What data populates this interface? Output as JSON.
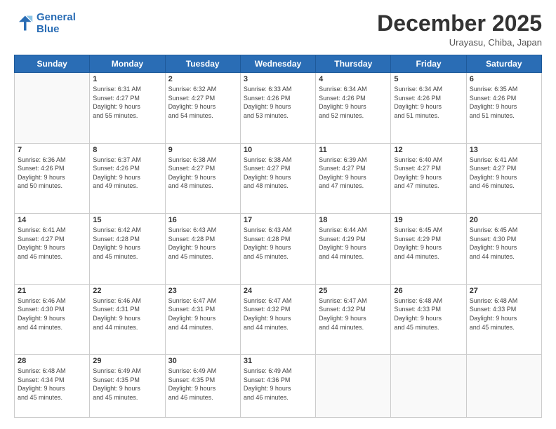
{
  "header": {
    "logo_line1": "General",
    "logo_line2": "Blue",
    "month_title": "December 2025",
    "location": "Urayasu, Chiba, Japan"
  },
  "weekdays": [
    "Sunday",
    "Monday",
    "Tuesday",
    "Wednesday",
    "Thursday",
    "Friday",
    "Saturday"
  ],
  "weeks": [
    [
      {
        "day": "",
        "info": ""
      },
      {
        "day": "1",
        "info": "Sunrise: 6:31 AM\nSunset: 4:27 PM\nDaylight: 9 hours\nand 55 minutes."
      },
      {
        "day": "2",
        "info": "Sunrise: 6:32 AM\nSunset: 4:27 PM\nDaylight: 9 hours\nand 54 minutes."
      },
      {
        "day": "3",
        "info": "Sunrise: 6:33 AM\nSunset: 4:26 PM\nDaylight: 9 hours\nand 53 minutes."
      },
      {
        "day": "4",
        "info": "Sunrise: 6:34 AM\nSunset: 4:26 PM\nDaylight: 9 hours\nand 52 minutes."
      },
      {
        "day": "5",
        "info": "Sunrise: 6:34 AM\nSunset: 4:26 PM\nDaylight: 9 hours\nand 51 minutes."
      },
      {
        "day": "6",
        "info": "Sunrise: 6:35 AM\nSunset: 4:26 PM\nDaylight: 9 hours\nand 51 minutes."
      }
    ],
    [
      {
        "day": "7",
        "info": "Sunrise: 6:36 AM\nSunset: 4:26 PM\nDaylight: 9 hours\nand 50 minutes."
      },
      {
        "day": "8",
        "info": "Sunrise: 6:37 AM\nSunset: 4:26 PM\nDaylight: 9 hours\nand 49 minutes."
      },
      {
        "day": "9",
        "info": "Sunrise: 6:38 AM\nSunset: 4:27 PM\nDaylight: 9 hours\nand 48 minutes."
      },
      {
        "day": "10",
        "info": "Sunrise: 6:38 AM\nSunset: 4:27 PM\nDaylight: 9 hours\nand 48 minutes."
      },
      {
        "day": "11",
        "info": "Sunrise: 6:39 AM\nSunset: 4:27 PM\nDaylight: 9 hours\nand 47 minutes."
      },
      {
        "day": "12",
        "info": "Sunrise: 6:40 AM\nSunset: 4:27 PM\nDaylight: 9 hours\nand 47 minutes."
      },
      {
        "day": "13",
        "info": "Sunrise: 6:41 AM\nSunset: 4:27 PM\nDaylight: 9 hours\nand 46 minutes."
      }
    ],
    [
      {
        "day": "14",
        "info": "Sunrise: 6:41 AM\nSunset: 4:27 PM\nDaylight: 9 hours\nand 46 minutes."
      },
      {
        "day": "15",
        "info": "Sunrise: 6:42 AM\nSunset: 4:28 PM\nDaylight: 9 hours\nand 45 minutes."
      },
      {
        "day": "16",
        "info": "Sunrise: 6:43 AM\nSunset: 4:28 PM\nDaylight: 9 hours\nand 45 minutes."
      },
      {
        "day": "17",
        "info": "Sunrise: 6:43 AM\nSunset: 4:28 PM\nDaylight: 9 hours\nand 45 minutes."
      },
      {
        "day": "18",
        "info": "Sunrise: 6:44 AM\nSunset: 4:29 PM\nDaylight: 9 hours\nand 44 minutes."
      },
      {
        "day": "19",
        "info": "Sunrise: 6:45 AM\nSunset: 4:29 PM\nDaylight: 9 hours\nand 44 minutes."
      },
      {
        "day": "20",
        "info": "Sunrise: 6:45 AM\nSunset: 4:30 PM\nDaylight: 9 hours\nand 44 minutes."
      }
    ],
    [
      {
        "day": "21",
        "info": "Sunrise: 6:46 AM\nSunset: 4:30 PM\nDaylight: 9 hours\nand 44 minutes."
      },
      {
        "day": "22",
        "info": "Sunrise: 6:46 AM\nSunset: 4:31 PM\nDaylight: 9 hours\nand 44 minutes."
      },
      {
        "day": "23",
        "info": "Sunrise: 6:47 AM\nSunset: 4:31 PM\nDaylight: 9 hours\nand 44 minutes."
      },
      {
        "day": "24",
        "info": "Sunrise: 6:47 AM\nSunset: 4:32 PM\nDaylight: 9 hours\nand 44 minutes."
      },
      {
        "day": "25",
        "info": "Sunrise: 6:47 AM\nSunset: 4:32 PM\nDaylight: 9 hours\nand 44 minutes."
      },
      {
        "day": "26",
        "info": "Sunrise: 6:48 AM\nSunset: 4:33 PM\nDaylight: 9 hours\nand 45 minutes."
      },
      {
        "day": "27",
        "info": "Sunrise: 6:48 AM\nSunset: 4:33 PM\nDaylight: 9 hours\nand 45 minutes."
      }
    ],
    [
      {
        "day": "28",
        "info": "Sunrise: 6:48 AM\nSunset: 4:34 PM\nDaylight: 9 hours\nand 45 minutes."
      },
      {
        "day": "29",
        "info": "Sunrise: 6:49 AM\nSunset: 4:35 PM\nDaylight: 9 hours\nand 45 minutes."
      },
      {
        "day": "30",
        "info": "Sunrise: 6:49 AM\nSunset: 4:35 PM\nDaylight: 9 hours\nand 46 minutes."
      },
      {
        "day": "31",
        "info": "Sunrise: 6:49 AM\nSunset: 4:36 PM\nDaylight: 9 hours\nand 46 minutes."
      },
      {
        "day": "",
        "info": ""
      },
      {
        "day": "",
        "info": ""
      },
      {
        "day": "",
        "info": ""
      }
    ]
  ]
}
